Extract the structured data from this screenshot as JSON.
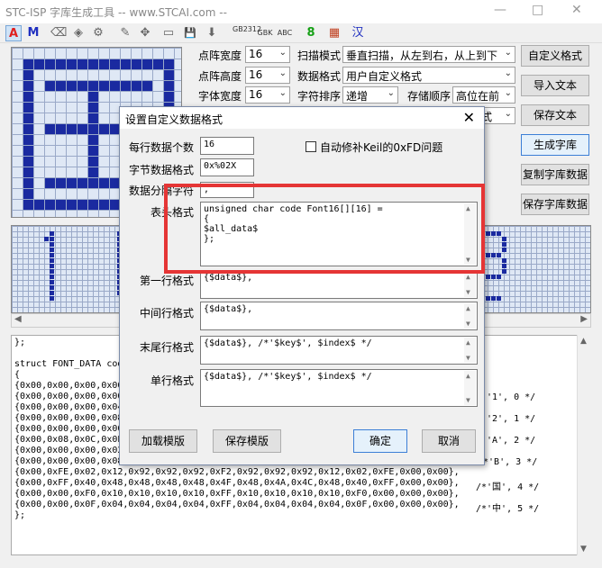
{
  "window": {
    "title": "STC-ISP 字库生成工具 -- www.STCAI.com --",
    "controls": [
      "—",
      "□",
      "✕"
    ]
  },
  "toolbar": {
    "items": [
      "A",
      "M",
      "⌫",
      "◈",
      "⚙",
      "✎",
      "✥",
      "▭",
      "💾",
      "⬇",
      "GB2312",
      "GBK",
      "ABC",
      "8",
      "▦",
      "汉"
    ]
  },
  "settings": {
    "dot_width_label": "点阵宽度",
    "dot_width_value": "16",
    "dot_height_label": "点阵高度",
    "dot_height_value": "16",
    "char_width_label": "字体宽度",
    "char_width_value": "16",
    "scan_mode_label": "扫描模式",
    "scan_mode_value": "垂直扫描，从左到右，从上到下",
    "data_format_label": "数据格式",
    "data_format_value": "用户自定义格式",
    "char_order_label": "字符排序",
    "char_order_value": "递增",
    "store_order_label": "存储顺序",
    "store_order_value": "高位在前",
    "partial_value": "式"
  },
  "right_buttons": {
    "custom_format": "自定义格式",
    "import_text": "导入文本",
    "save_text": "保存文本",
    "generate": "生成字库",
    "copy_data": "复制字库数据",
    "save_data": "保存字库数据"
  },
  "output": {
    "lines": [
      "};",
      "",
      "struct FONT_DATA code",
      "{",
      "{0x00,0x00,0x00,0x00",
      "{0x00,0x00,0x00,0x00",
      "{0x00,0x00,0x00,0x04",
      "{0x00,0x00,0x00,0x08",
      "{0x00,0x00,0x00,0x00",
      "{0x00,0x08,0x0C,0x0E",
      "{0x00,0x00,0x00,0x02",
      "{0x00,0x00,0x00,0x08,0x0F,0x08,0x08,0x08,0x08,0x08,0x07,0x00,0x00,0x00,0x00},",
      "{0x00,0xFE,0x02,0x12,0x92,0x92,0x92,0xF2,0x92,0x92,0x92,0x12,0x02,0xFE,0x00,0x00},",
      "{0x00,0xFF,0x40,0x48,0x48,0x48,0x48,0x4F,0x48,0x4A,0x4C,0x48,0x40,0xFF,0x00,0x00},",
      "{0x00,0x00,0xF0,0x10,0x10,0x10,0x10,0xFF,0x10,0x10,0x10,0x10,0xF0,0x00,0x00,0x00},",
      "{0x00,0x00,0x0F,0x04,0x04,0x04,0x04,0xFF,0x04,0x04,0x04,0x04,0x0F,0x00,0x00,0x00},",
      "};"
    ],
    "comments": [
      "'1', 0 */",
      "'2', 1 */",
      "'A', 2 */",
      "/*'B', 3 */",
      "/*'国', 4 */",
      "/*'中', 5 */"
    ]
  },
  "dialog": {
    "title": "设置自定义数据格式",
    "bytes_per_row_label": "每行数据个数",
    "bytes_per_row_value": "16",
    "auto_fix_label": "自动修补Keil的0xFD问题",
    "byte_format_label": "字节数据格式",
    "byte_format_value": "0x%02X",
    "separator_label": "数据分隔字符",
    "separator_value": ",",
    "table_format_label": "表头格式",
    "table_format_lines": [
      "unsigned char code Font16[][16] =",
      "{",
      "$all_data$",
      "};"
    ],
    "first_row_label": "第一行格式",
    "first_row_value": "{$data$},",
    "middle_row_label": "中间行格式",
    "middle_row_value": "{$data$},",
    "last_row_label": "末尾行格式",
    "last_row_value": "{$data$}, /*'$key$', $index$ */",
    "single_row_label": "单行格式",
    "single_row_value": "{$data$}, /*'$key$', $index$ */",
    "load_template": "加载模版",
    "save_template": "保存模版",
    "ok": "确定",
    "cancel": "取消"
  }
}
